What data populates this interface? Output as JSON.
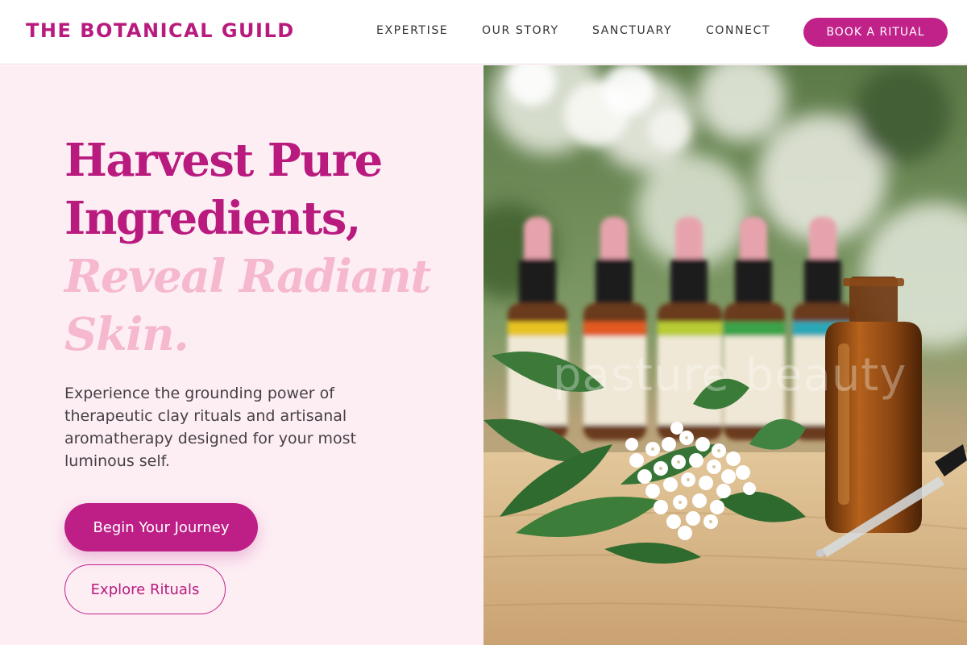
{
  "header": {
    "logo": "THE BOTANICAL GUILD",
    "nav": [
      "EXPERTISE",
      "OUR STORY",
      "SANCTUARY",
      "CONNECT"
    ],
    "cta": "BOOK A RITUAL"
  },
  "hero": {
    "headline_line1": "Harvest Pure",
    "headline_line2": "Ingredients,",
    "headline_line3": "Reveal Radiant",
    "headline_line4": "Skin.",
    "description": "Experience the grounding power of therapeutic clay rituals and artisanal aromatherapy designed for your most luminous self.",
    "primary_button": "Begin Your Journey",
    "secondary_button": "Explore Rituals",
    "image_watermark": "pasture beauty"
  },
  "colors": {
    "brand": "#b81a7e",
    "accent_light": "#f5b8cf",
    "panel_bg": "#fdeef4"
  }
}
